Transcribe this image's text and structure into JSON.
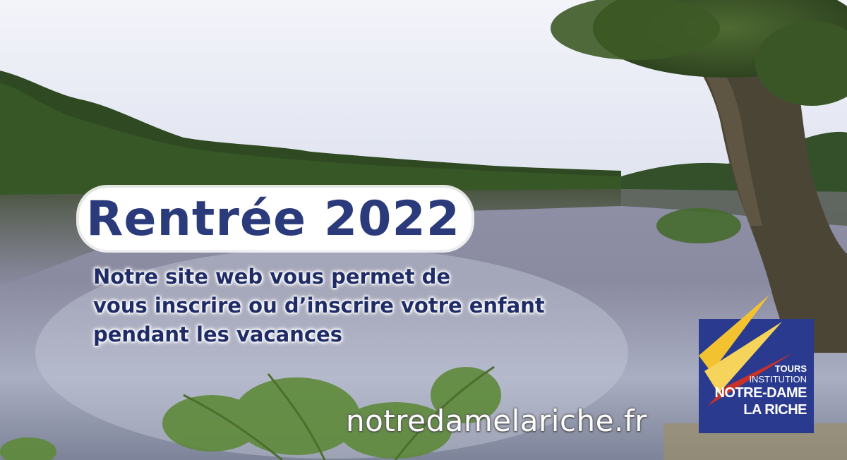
{
  "banner": {
    "headline": "Rentrée 2022",
    "subtext_lines": [
      "Notre site web vous permet de",
      "vous inscrire ou d’inscrire votre enfant",
      "pendant les vacances"
    ],
    "url": "notredamelariche.fr"
  },
  "logo": {
    "line1": "TOURS",
    "line2": "INSTITUTION",
    "line3": "NOTRE-DAME",
    "line4": "LA RICHE",
    "colors": {
      "background": "#293a8f",
      "yellow": "#f2c230",
      "red": "#c8302a"
    }
  },
  "colors": {
    "headline_text": "#2b3a7a",
    "subtext": "#1f2c66",
    "sky": "#e9ecf5",
    "water": "#7a7d95",
    "trees": "#2f4a22"
  }
}
